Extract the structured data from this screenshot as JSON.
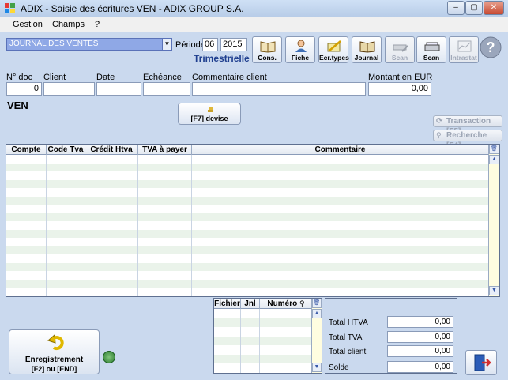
{
  "window": {
    "title": "ADIX - Saisie des écritures  VEN - ADIX GROUP S.A.",
    "min_glyph": "–",
    "max_glyph": "▢",
    "close_glyph": "✕"
  },
  "menu": [
    "Gestion",
    "Champs",
    "?"
  ],
  "journal": {
    "selected": "JOURNAL DES VENTES",
    "dropdown_glyph": "▼"
  },
  "periode": {
    "label": "Période",
    "month": "06",
    "year": "2015",
    "periodicite": "Trimestrielle"
  },
  "toolbar": [
    {
      "label": "Cons.",
      "icon": "open-book-icon",
      "enabled": true
    },
    {
      "label": "Fiche",
      "icon": "person-card-icon",
      "enabled": true
    },
    {
      "label": "Ecr.types",
      "icon": "pencil-notebook-icon",
      "enabled": true
    },
    {
      "label": "Journal",
      "icon": "journal-book-icon",
      "enabled": true
    },
    {
      "label": "Scan",
      "icon": "scanner-pen-icon",
      "enabled": false
    },
    {
      "label": "Scan",
      "icon": "scanner-icon",
      "enabled": true
    },
    {
      "label": "Intrastat",
      "icon": "intrastat-chart-icon",
      "enabled": false
    },
    {
      "label": "",
      "icon": "help-question-icon",
      "enabled": true
    }
  ],
  "header_fields": {
    "ndoc_label": "N° doc",
    "ndoc_value": "0",
    "client_label": "Client",
    "client_value": "",
    "date_label": "Date",
    "date_value": "",
    "echeance_label": "Echéance",
    "echeance_value": "",
    "commentaire_label": "Commentaire client",
    "commentaire_value": "",
    "montant_label": "Montant en EUR",
    "montant_value": "0,00"
  },
  "section_label": "VEN",
  "devise_button": "[F7] devise",
  "side_buttons": {
    "transaction": "Transaction [F5]",
    "recherche": "Recherche [F4]"
  },
  "grid": {
    "columns": [
      "Compte",
      "Code Tva",
      "Crédit Htva",
      "TVA à payer",
      "Commentaire"
    ],
    "rows": 17
  },
  "ref_grid": {
    "columns": [
      "Fichier",
      "Jnl",
      "Numéro"
    ],
    "rows": 7
  },
  "totals": [
    {
      "label": "Total HTVA",
      "value": "0,00"
    },
    {
      "label": "Total TVA",
      "value": "0,00"
    },
    {
      "label": "Total client",
      "value": "0,00"
    },
    {
      "label": "Solde",
      "value": "0,00"
    }
  ],
  "save_button": {
    "line1": "Enregistrement",
    "line2": "[F2] ou [END]"
  },
  "colors": {
    "window_bg": "#cad9ee",
    "journal_select_bg": "#8fa8e6",
    "row_alt": "#eaf3ea",
    "periodicite": "#1f3f8f"
  }
}
